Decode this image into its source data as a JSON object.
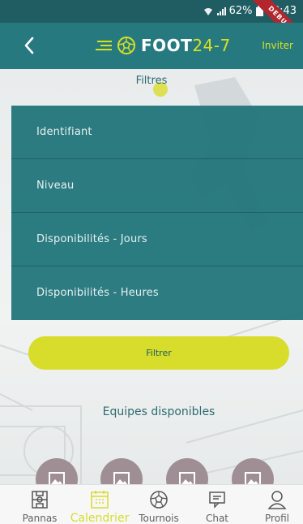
{
  "status_bar": {
    "battery": "62%",
    "time": "08:43"
  },
  "debug_ribbon": "DEBUG",
  "header": {
    "logo_main": "FOOT",
    "logo_accent": "24-7",
    "invite_label": "Inviter"
  },
  "filters": {
    "title": "Filtres",
    "items": [
      {
        "label": "Identifiant"
      },
      {
        "label": "Niveau"
      },
      {
        "label": "Disponibilités - Jours"
      },
      {
        "label": "Disponibilités - Heures"
      }
    ],
    "button_label": "Filtrer"
  },
  "teams": {
    "title": "Equipes disponibles"
  },
  "bottom_nav": {
    "items": [
      {
        "label": "Pannas",
        "icon": "pannas-icon"
      },
      {
        "label": "Calendrier",
        "icon": "calendar-icon",
        "active": true
      },
      {
        "label": "Tournois",
        "icon": "ball-icon"
      },
      {
        "label": "Chat",
        "icon": "chat-icon"
      },
      {
        "label": "Profil",
        "icon": "profile-icon"
      }
    ]
  },
  "colors": {
    "header": "#267a7f",
    "accent": "#d8e022",
    "menu": "#1f7479",
    "debug": "#b3262d"
  }
}
